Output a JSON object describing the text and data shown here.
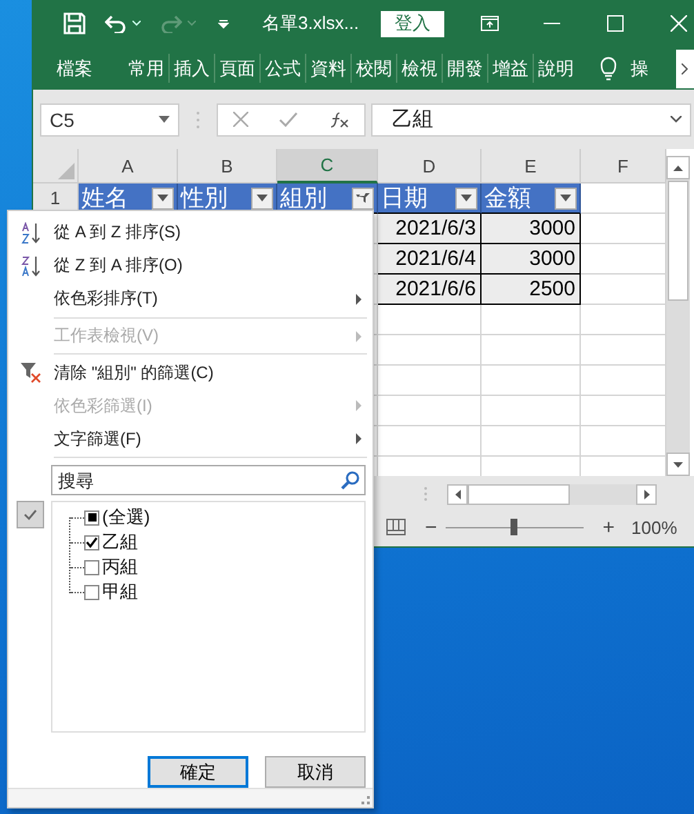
{
  "window": {
    "title": "名單3.xlsx...",
    "sign_in": "登入"
  },
  "ribbon_tabs": [
    {
      "label": "檔案"
    },
    {
      "label": "常用"
    },
    {
      "label": "插入"
    },
    {
      "label": "頁面"
    },
    {
      "label": "公式"
    },
    {
      "label": "資料"
    },
    {
      "label": "校閱"
    },
    {
      "label": "檢視"
    },
    {
      "label": "開發"
    },
    {
      "label": "增益"
    },
    {
      "label": "說明"
    }
  ],
  "tell_me": "操",
  "name_box": "C5",
  "formula": "乙組",
  "columns": [
    {
      "label": "A",
      "selected": false
    },
    {
      "label": "B",
      "selected": false
    },
    {
      "label": "C",
      "selected": true
    },
    {
      "label": "D",
      "selected": false
    },
    {
      "label": "E",
      "selected": false
    },
    {
      "label": "F",
      "selected": false
    }
  ],
  "header_row": {
    "number": "1",
    "cells": [
      {
        "text": "姓名",
        "filtered": false
      },
      {
        "text": "性別",
        "filtered": false
      },
      {
        "text": "組別",
        "filtered": true
      },
      {
        "text": "日期",
        "filtered": false
      },
      {
        "text": "金額",
        "filtered": false
      }
    ]
  },
  "data_rows": [
    {
      "date": "2021/6/3",
      "amount": "3000"
    },
    {
      "date": "2021/6/4",
      "amount": "3000"
    },
    {
      "date": "2021/6/6",
      "amount": "2500"
    }
  ],
  "zoom": {
    "minus": "−",
    "level": 0.5,
    "plus": "+",
    "reading": "100%"
  },
  "menu": {
    "items": [
      {
        "kind": "sort_asc",
        "label": "從 A 到 Z 排序(S)",
        "disabled": false,
        "submenu": false
      },
      {
        "kind": "sort_desc",
        "label": "從 Z 到 A 排序(O)",
        "disabled": false,
        "submenu": false
      },
      {
        "kind": "plain",
        "label": "依色彩排序(T)",
        "disabled": false,
        "submenu": true
      },
      {
        "kind": "separator"
      },
      {
        "kind": "plain",
        "label": "工作表檢視(V)",
        "disabled": true,
        "submenu": true
      },
      {
        "kind": "separator"
      },
      {
        "kind": "clear_filter",
        "label": "清除 \"組別\" 的篩選(C)",
        "disabled": false,
        "submenu": false
      },
      {
        "kind": "plain",
        "label": "依色彩篩選(I)",
        "disabled": true,
        "submenu": true
      },
      {
        "kind": "plain",
        "label": "文字篩選(F)",
        "disabled": false,
        "submenu": true
      },
      {
        "kind": "separator"
      }
    ],
    "search": {
      "placeholder": "搜尋"
    },
    "select_all": {
      "label": "(全選)",
      "partial": true
    },
    "values": [
      {
        "label": "乙組",
        "checked": true
      },
      {
        "label": "丙組",
        "checked": false
      },
      {
        "label": "甲組",
        "checked": false
      }
    ],
    "buttons": [
      {
        "label": "確定",
        "default": true
      },
      {
        "label": "取消",
        "default": false
      }
    ]
  }
}
